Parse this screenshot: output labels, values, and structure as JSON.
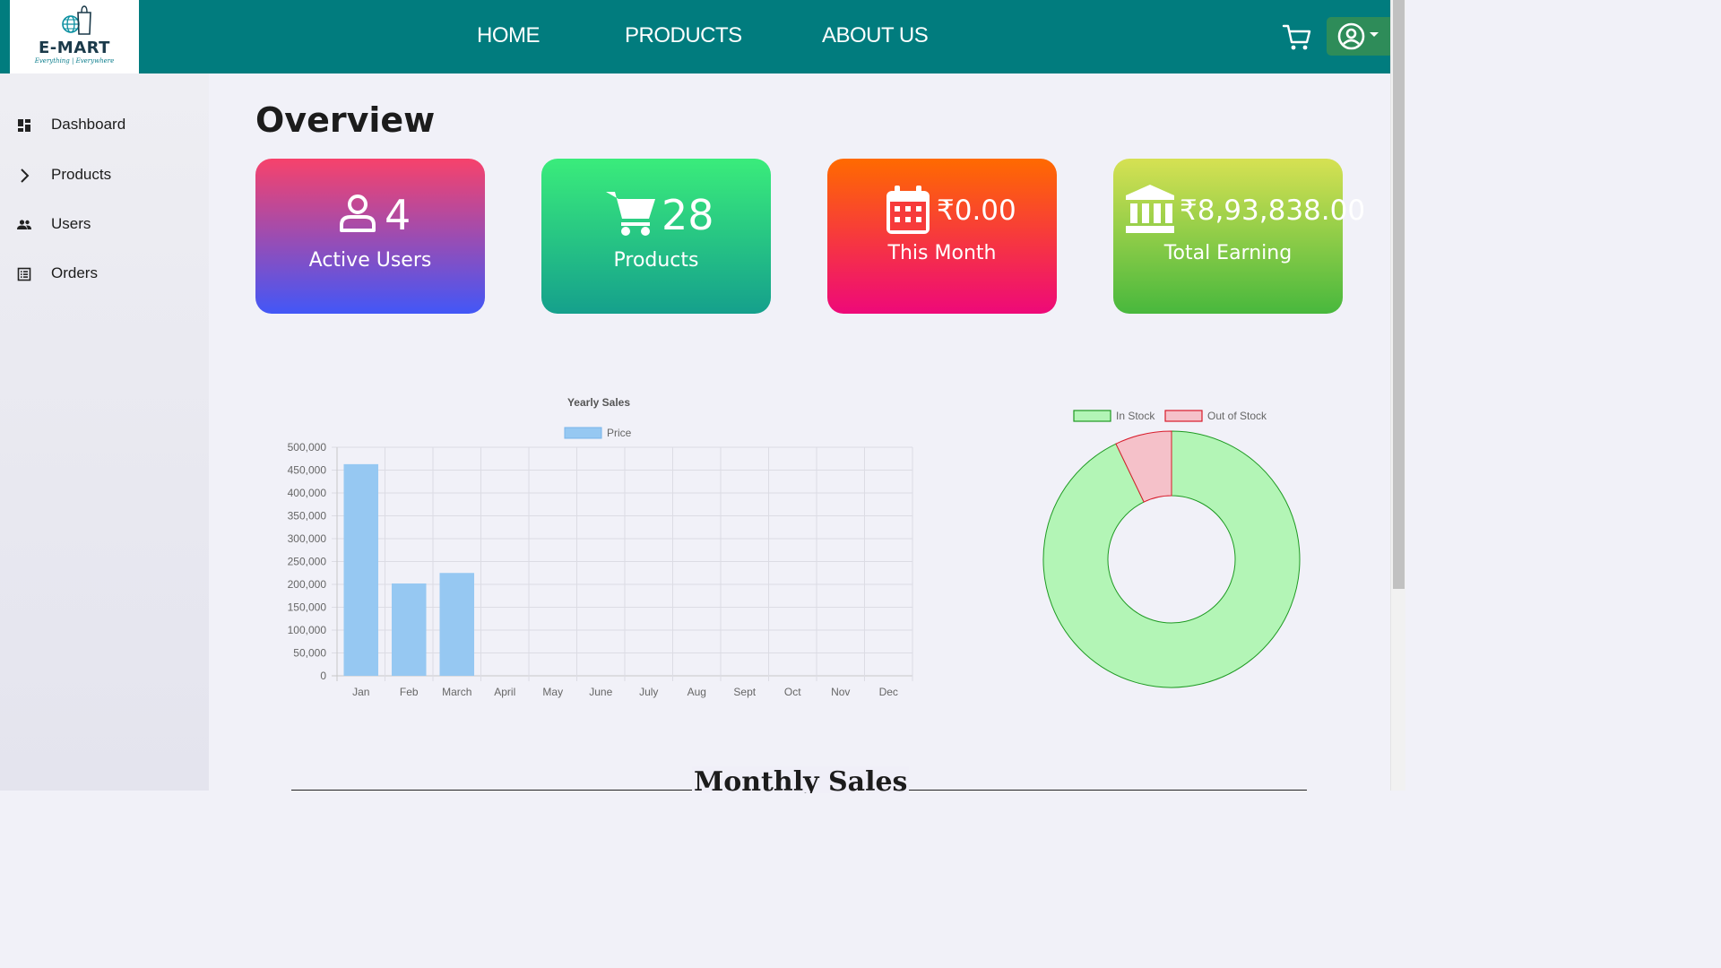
{
  "brand": {
    "name": "E-MART",
    "tagline": "Everything | Everywhere"
  },
  "nav": {
    "links": [
      "HOME",
      "PRODUCTS",
      "ABOUT US"
    ]
  },
  "sidebar": {
    "items": [
      {
        "label": "Dashboard",
        "icon": "dashboard-icon"
      },
      {
        "label": "Products",
        "icon": "chevron-right-icon"
      },
      {
        "label": "Users",
        "icon": "users-icon"
      },
      {
        "label": "Orders",
        "icon": "orders-icon"
      }
    ]
  },
  "main": {
    "title": "Overview"
  },
  "cards": [
    {
      "value": "4",
      "label": "Active Users",
      "icon": "user-icon",
      "gradient": [
        "#f7426b",
        "#4257f7"
      ]
    },
    {
      "value": "28",
      "label": "Products",
      "icon": "cart-icon",
      "gradient": [
        "#3aec7b",
        "#15a08c"
      ]
    },
    {
      "value": "₹0.00",
      "label": "This Month",
      "icon": "calendar-icon",
      "gradient": [
        "#ff6a00",
        "#ee0979"
      ]
    },
    {
      "value": "₹8,93,838.00",
      "label": "Total Earning",
      "icon": "bank-icon",
      "gradient": [
        "#d6e153",
        "#48b83d"
      ]
    }
  ],
  "chart_data": [
    {
      "type": "bar",
      "title": "Yearly Sales",
      "categories": [
        "Jan",
        "Feb",
        "March",
        "April",
        "May",
        "June",
        "July",
        "Aug",
        "Sept",
        "Oct",
        "Nov",
        "Dec"
      ],
      "series": [
        {
          "name": "Price",
          "values": [
            463000,
            202000,
            225000,
            0,
            0,
            0,
            0,
            0,
            0,
            0,
            0,
            0
          ]
        }
      ],
      "ylim": [
        0,
        500000
      ],
      "yticks": [
        "0",
        "50,000",
        "100,000",
        "150,000",
        "200,000",
        "250,000",
        "300,000",
        "350,000",
        "400,000",
        "450,000",
        "500,000"
      ],
      "grid": true,
      "legend": "top",
      "colors": {
        "fill": "#96c8f2",
        "stroke": "#79b5ea"
      }
    },
    {
      "type": "pie",
      "variant": "doughnut",
      "categories": [
        "In Stock",
        "Out of Stock"
      ],
      "values": [
        26,
        2
      ],
      "legend": "top",
      "colors": {
        "In Stock": "#b3f5b6",
        "Out of Stock": "#f5c1c9",
        "In Stock border": "#1e9a22",
        "Out of Stock border": "#d81b2a"
      }
    }
  ],
  "monthly": {
    "title": "Monthly Sales"
  }
}
